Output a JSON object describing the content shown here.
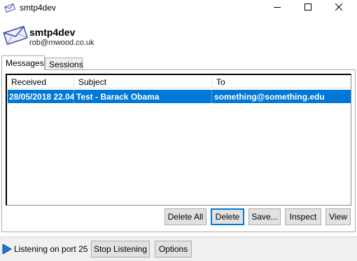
{
  "window": {
    "title": "smtp4dev",
    "icon": "envelope-icon",
    "controls": [
      "minimize-icon",
      "maximize-icon",
      "close-icon"
    ]
  },
  "header": {
    "app_name": "smtp4dev",
    "author": "rob@rnwood.co.uk",
    "icon": "envelope-icon"
  },
  "tabs": [
    {
      "label": "Messages",
      "active": true
    },
    {
      "label": "Sessions",
      "active": false
    }
  ],
  "messages": {
    "columns": [
      "Received",
      "Subject",
      "To"
    ],
    "rows": [
      {
        "received": "28/05/2018 22.04",
        "subject": "Test - Barack Obama",
        "to": "something@something.edu",
        "selected": true
      }
    ]
  },
  "actions": {
    "delete_all": "Delete All",
    "delete": "Delete",
    "save": "Save...",
    "inspect": "Inspect",
    "view": "View"
  },
  "status": {
    "text": "Listening on port 25",
    "stop_label": "Stop Listening",
    "options_label": "Options",
    "icon": "play-icon"
  },
  "colors": {
    "selection": "#0078d7",
    "focus_border": "#0078d7",
    "status_icon": "#1e74d0"
  }
}
